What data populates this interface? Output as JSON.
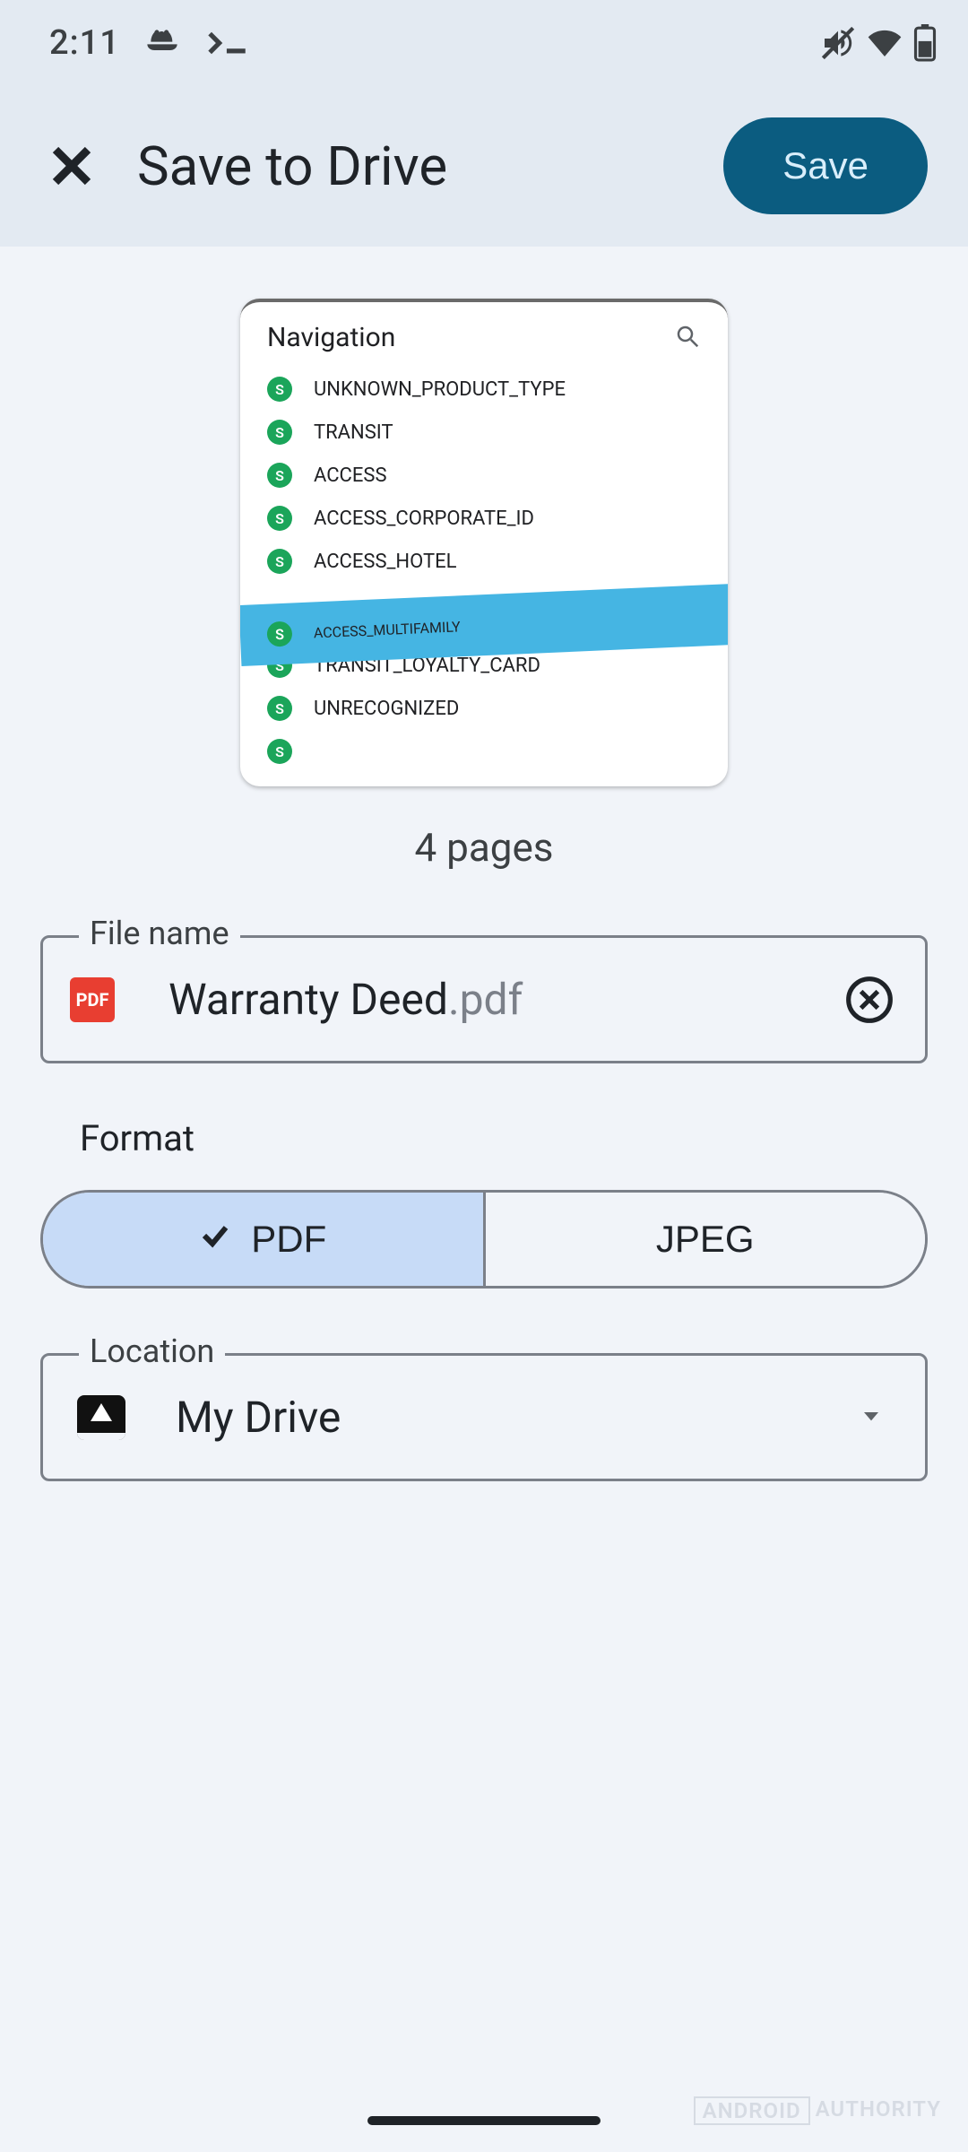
{
  "status": {
    "time": "2:11"
  },
  "appbar": {
    "title": "Save to Drive",
    "save_label": "Save"
  },
  "preview": {
    "header": "Navigation",
    "items": [
      "UNKNOWN_PRODUCT_TYPE",
      "TRANSIT",
      "ACCESS",
      "ACCESS_CORPORATE_ID",
      "ACCESS_HOTEL",
      "ACCESS_MULTIFAMILY",
      "TRANSIT_LOYALTY_CARD",
      "UNRECOGNIZED"
    ],
    "badge_letter": "S"
  },
  "page_count_text": "4 pages",
  "filename": {
    "label": "File name",
    "badge": "PDF",
    "value": "Warranty Deed",
    "ext": ".pdf"
  },
  "format": {
    "label": "Format",
    "pdf": "PDF",
    "jpeg": "JPEG"
  },
  "location": {
    "label": "Location",
    "value": "My Drive"
  },
  "watermark": {
    "a": "ANDROID",
    "b": "AUTHORITY"
  }
}
